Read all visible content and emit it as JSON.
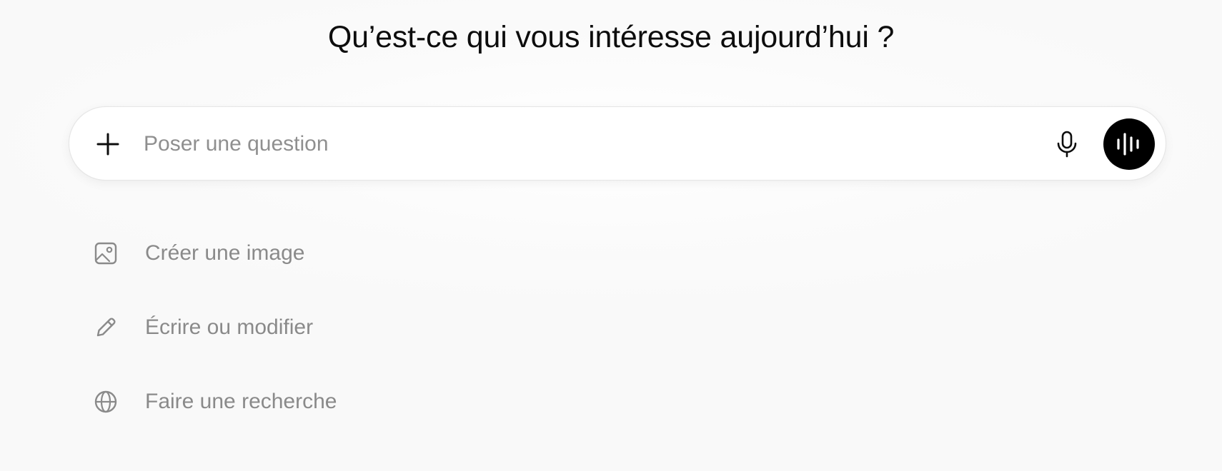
{
  "header": {
    "title": "Qu’est-ce qui vous intéresse aujourd’hui ?"
  },
  "composer": {
    "placeholder": "Poser une question",
    "value": "",
    "attach_icon": "plus-icon",
    "mic_icon": "microphone-icon",
    "voice_icon": "waveform-icon",
    "voice_button_color": "#000000"
  },
  "suggestions": [
    {
      "label": "Créer une image",
      "icon": "image-icon"
    },
    {
      "label": "Écrire ou modifier",
      "icon": "pencil-icon"
    },
    {
      "label": "Faire une recherche",
      "icon": "globe-icon"
    }
  ]
}
